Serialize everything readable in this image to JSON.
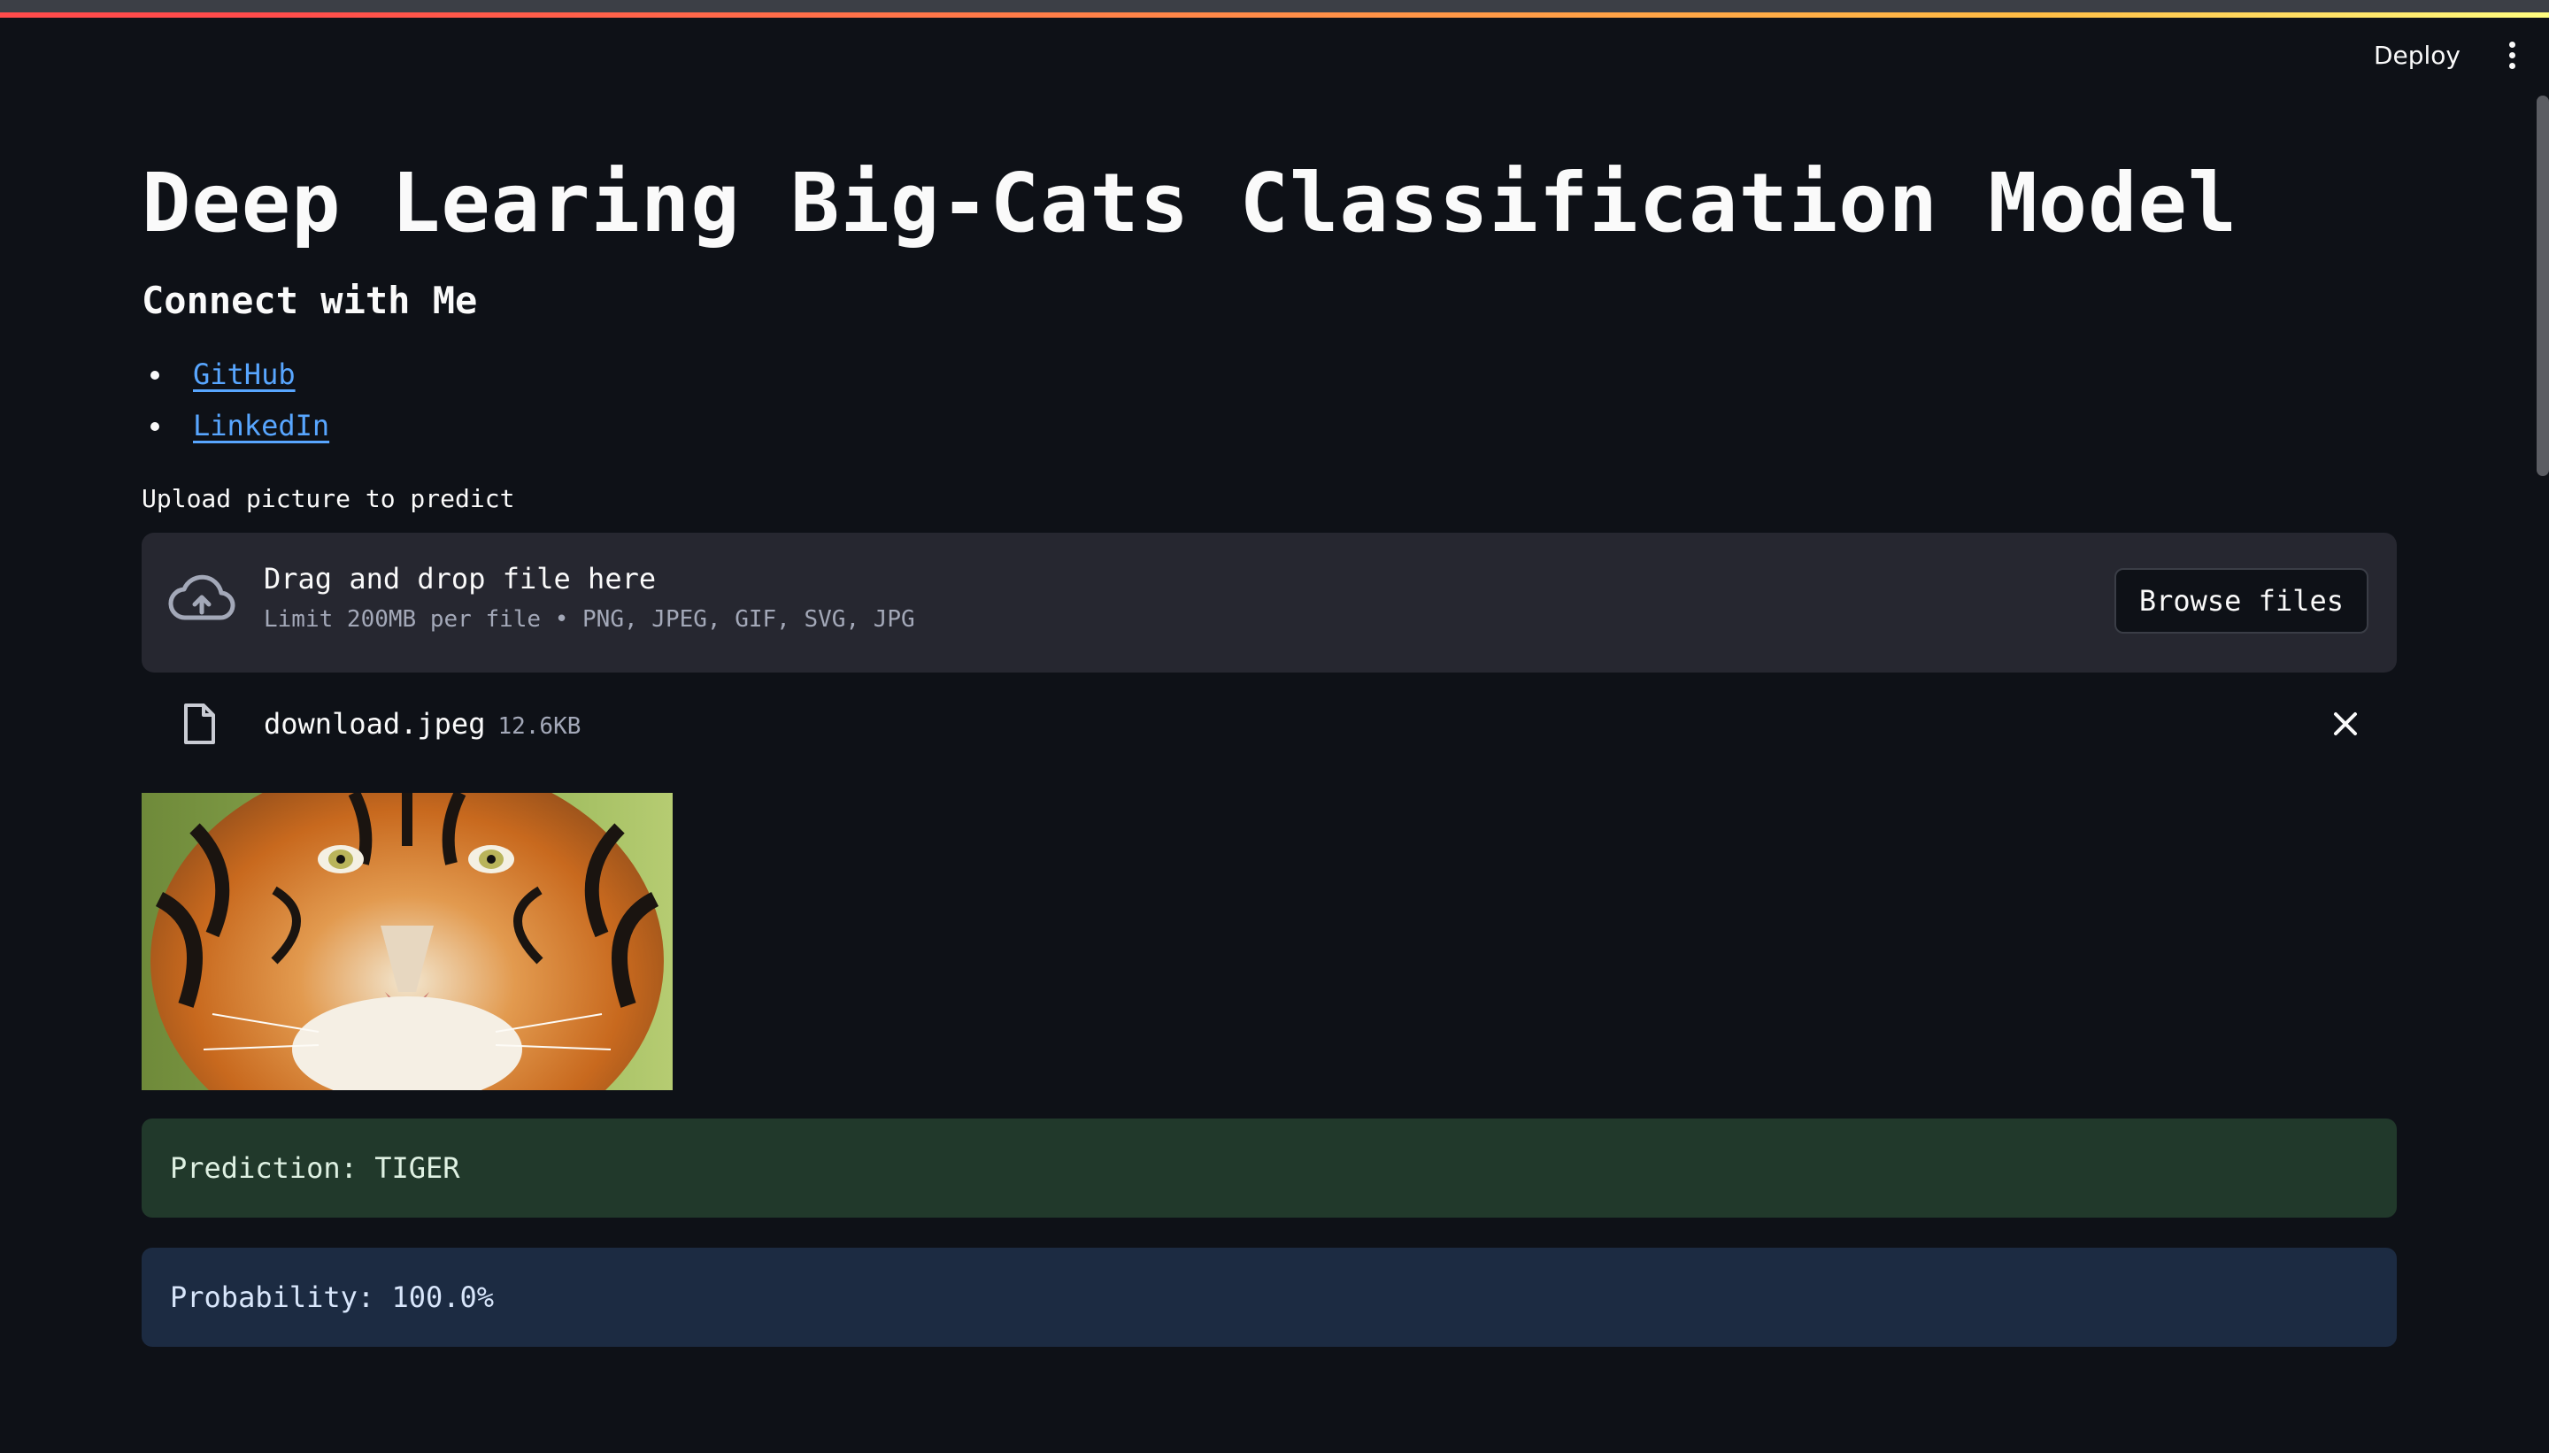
{
  "header": {
    "deploy_label": "Deploy"
  },
  "main": {
    "title": "Deep Learing Big-Cats Classification Model",
    "subtitle": "Connect with Me",
    "links": [
      {
        "label": "GitHub"
      },
      {
        "label": "LinkedIn"
      }
    ],
    "upload": {
      "label": "Upload picture to predict",
      "drop_title": "Drag and drop file here",
      "limit_text": "Limit 200MB per file • PNG, JPEG, GIF, SVG, JPG",
      "browse_label": "Browse files"
    },
    "file": {
      "name": "download.jpeg",
      "size": "12.6KB"
    },
    "prediction": "Prediction: TIGER",
    "probability": "Probability: 100.0%"
  },
  "colors": {
    "background": "#0e1117",
    "link": "#58a6ff",
    "success_bg": "#21392b",
    "info_bg": "#1c2b42",
    "dropzone_bg": "#262730"
  },
  "icons": {
    "upload": "cloud-upload-icon",
    "file": "file-icon",
    "close": "close-icon",
    "menu": "more-vertical-icon"
  }
}
